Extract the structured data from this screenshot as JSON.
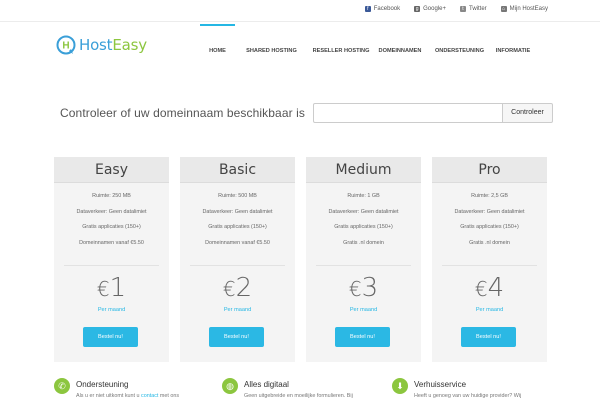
{
  "topbar": {
    "links": [
      {
        "icon": "facebook-icon",
        "label": "Facebook"
      },
      {
        "icon": "google-plus-icon",
        "label": "Google+"
      },
      {
        "icon": "twitter-icon",
        "label": "Twitter"
      },
      {
        "icon": "home-icon",
        "label": "Mijn HostEasy"
      }
    ]
  },
  "logo": {
    "part1": "Host",
    "part2": "Easy",
    "mark": "H"
  },
  "nav": {
    "items": [
      "HOME",
      "SHARED HOSTING",
      "RESELLER HOSTING",
      "DOMEINNAMEN",
      "ONDERSTEUNING",
      "INFORMATIE"
    ],
    "active": "HOME"
  },
  "domain_search": {
    "label": "Controleer of uw domeinnaam beschikbaar is",
    "input_value": "",
    "button_label": "Controleer"
  },
  "plans": [
    {
      "name": "Easy",
      "features": [
        "Ruimte: 250 MB",
        "Dataverkeer: Geen datalimiet",
        "Gratis applicaties (150+)",
        "Domeinnamen vanaf €5.50"
      ],
      "currency": "€",
      "price": "1",
      "period": "Per maand",
      "button": "Bestel nu!"
    },
    {
      "name": "Basic",
      "features": [
        "Ruimte: 500 MB",
        "Dataverkeer: Geen datalimiet",
        "Gratis applicaties (150+)",
        "Domeinnamen vanaf €5.50"
      ],
      "currency": "€",
      "price": "2",
      "period": "Per maand",
      "button": "Bestel nu!"
    },
    {
      "name": "Medium",
      "features": [
        "Ruimte: 1 GB",
        "Dataverkeer: Geen datalimiet",
        "Gratis applicaties (150+)",
        "Gratis .nl domein"
      ],
      "currency": "€",
      "price": "3",
      "period": "Per maand",
      "button": "Bestel nu!"
    },
    {
      "name": "Pro",
      "features": [
        "Ruimte: 2,5 GB",
        "Dataverkeer: Geen datalimiet",
        "Gratis applicaties (150+)",
        "Gratis .nl domein"
      ],
      "currency": "€",
      "price": "4",
      "period": "Per maand",
      "button": "Bestel nu!"
    }
  ],
  "features_strip": [
    {
      "icon": "phone-icon",
      "color": "#8cc63f",
      "title": "Ondersteuning",
      "text_before": "Als u er niet uitkomt kunt u ",
      "link": "contact",
      "text_after": " met ons"
    },
    {
      "icon": "globe-icon",
      "color": "#8cc63f",
      "title": "Alles digitaal",
      "text_before": "Geen uitgebreide en moeilijke formulieren. Bij",
      "link": "",
      "text_after": ""
    },
    {
      "icon": "download-icon",
      "color": "#8cc63f",
      "title": "Verhuisservice",
      "text_before": "Heeft u genoeg van uw huidige provider? Wij",
      "link": "",
      "text_after": ""
    }
  ],
  "colors": {
    "accent": "#25b7e4",
    "logo_blue": "#3a9fd8",
    "logo_green": "#8cc63f"
  }
}
